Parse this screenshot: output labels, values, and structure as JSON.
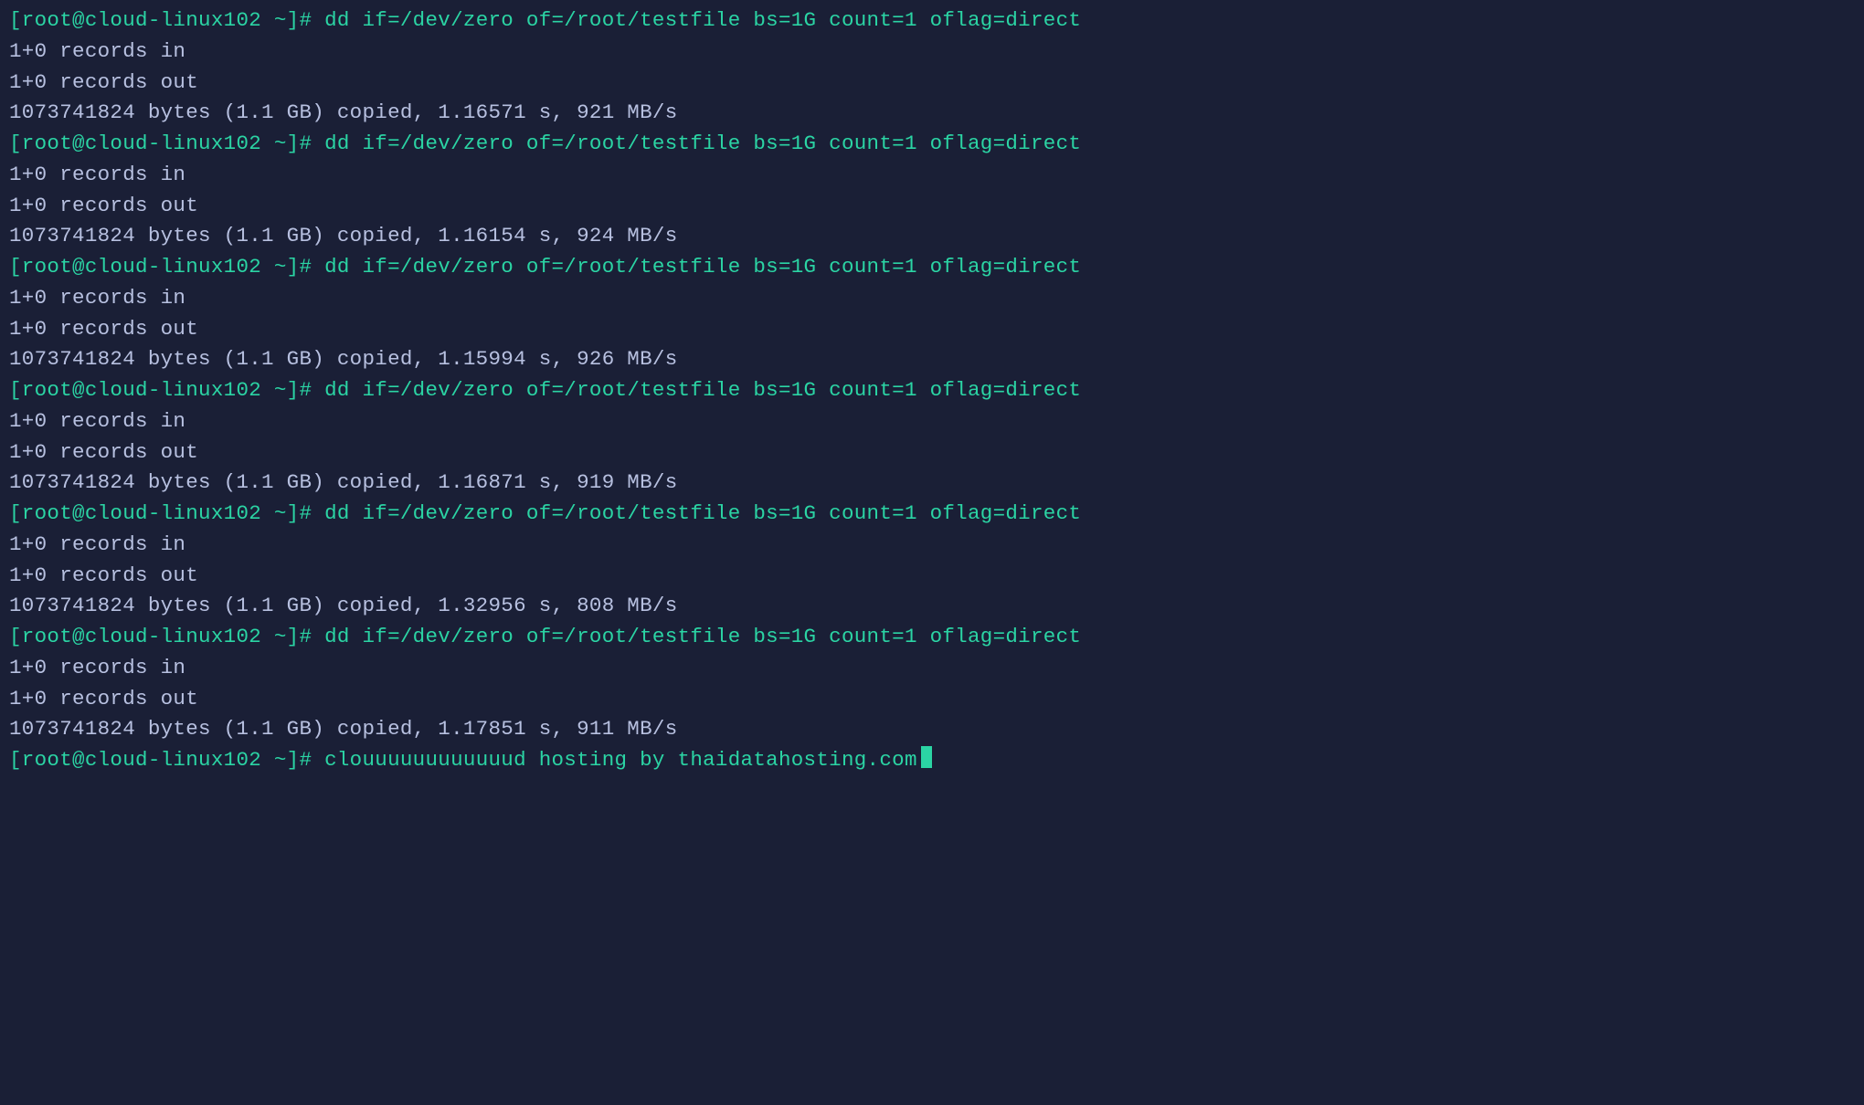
{
  "prompt": "[root@cloud-linux102 ~]# ",
  "dd_command": "dd if=/dev/zero of=/root/testfile bs=1G count=1 oflag=direct",
  "runs": [
    {
      "records_in": "1+0 records in",
      "records_out": "1+0 records out",
      "summary": "1073741824 bytes (1.1 GB) copied, 1.16571 s, 921 MB/s"
    },
    {
      "records_in": "1+0 records in",
      "records_out": "1+0 records out",
      "summary": "1073741824 bytes (1.1 GB) copied, 1.16154 s, 924 MB/s"
    },
    {
      "records_in": "1+0 records in",
      "records_out": "1+0 records out",
      "summary": "1073741824 bytes (1.1 GB) copied, 1.15994 s, 926 MB/s"
    },
    {
      "records_in": "1+0 records in",
      "records_out": "1+0 records out",
      "summary": "1073741824 bytes (1.1 GB) copied, 1.16871 s, 919 MB/s"
    },
    {
      "records_in": "1+0 records in",
      "records_out": "1+0 records out",
      "summary": "1073741824 bytes (1.1 GB) copied, 1.32956 s, 808 MB/s"
    },
    {
      "records_in": "1+0 records in",
      "records_out": "1+0 records out",
      "summary": "1073741824 bytes (1.1 GB) copied, 1.17851 s, 911 MB/s"
    }
  ],
  "final_input": "clouuuuuuuuuuuud hosting by thaidatahosting.com"
}
